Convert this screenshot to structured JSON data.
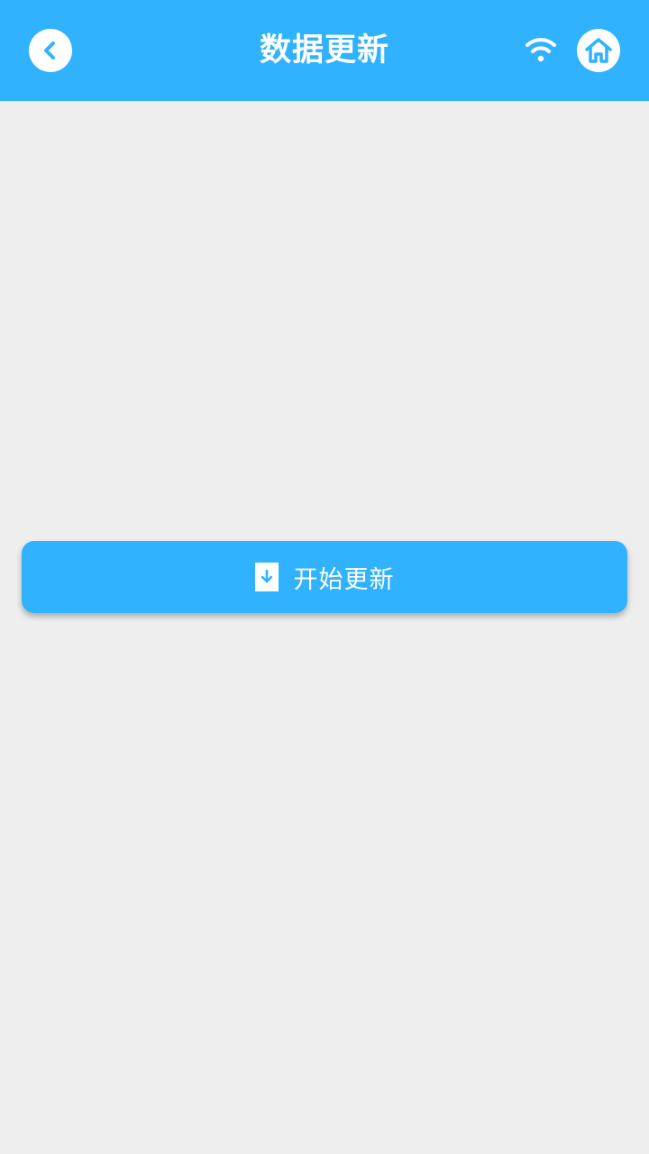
{
  "header": {
    "title": "数据更新",
    "back_icon": "chevron-left-icon",
    "wifi_icon": "wifi-icon",
    "home_icon": "home-icon"
  },
  "main": {
    "update_button_label": "开始更新",
    "update_button_icon": "download-icon"
  },
  "colors": {
    "primary": "#31b2fe",
    "background": "#eeeeee",
    "on_primary": "#ffffff"
  }
}
